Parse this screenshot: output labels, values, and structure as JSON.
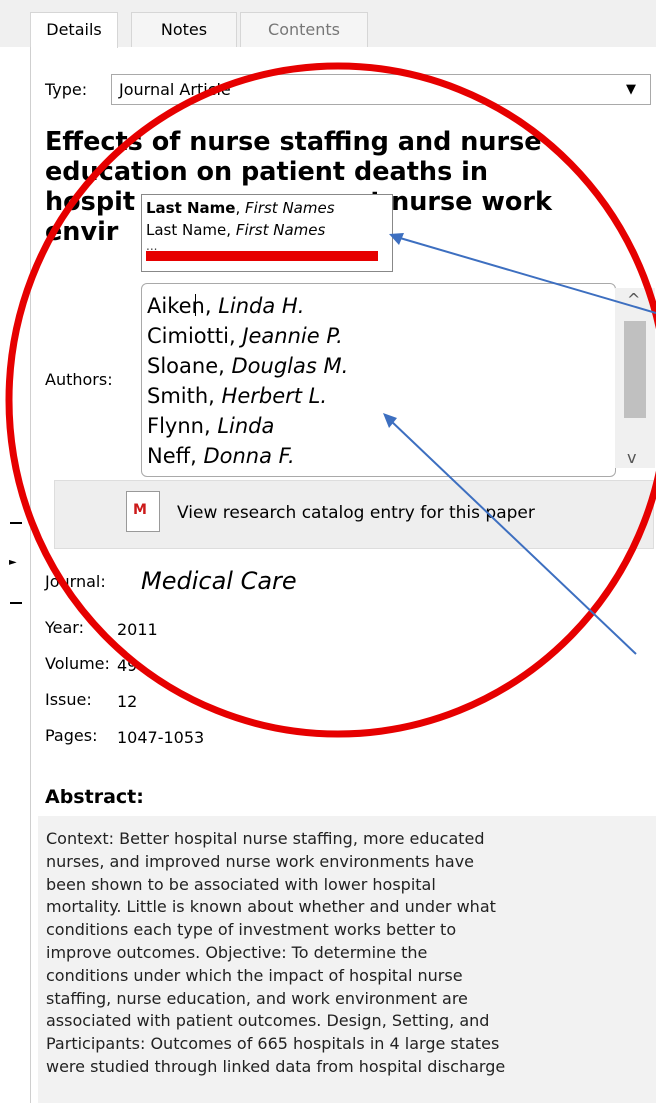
{
  "tabs": {
    "details": "Details",
    "notes": "Notes",
    "contents": "Contents"
  },
  "type_field": {
    "label": "Type:",
    "value": "Journal Article"
  },
  "title": "Effects of nurse staffing and nurse education on patient deaths in hospitals with different nurse work environments",
  "title_lines": [
    "Effects of nurse staffing and nurse",
    "education on patient deaths in",
    "hospit",
    "envir"
  ],
  "title_line3_tail": "t nurse work",
  "autocomplete": {
    "item1_last": "Last Name",
    "item1_first": "First Names",
    "item2_last": "Last Name",
    "item2_first": "First Names",
    "more": "..."
  },
  "authors": {
    "label": "Authors:",
    "items": [
      {
        "last": "Aiken",
        "first": "Linda H."
      },
      {
        "last": "Cimiotti",
        "first": "Jeannie P."
      },
      {
        "last": "Sloane",
        "first": "Douglas M."
      },
      {
        "last": "Smith",
        "first": "Herbert L."
      },
      {
        "last": "Flynn",
        "first": "Linda"
      },
      {
        "last": "Neff",
        "first": "Donna F."
      }
    ]
  },
  "catalog_button": {
    "label": "View research catalog entry for this paper",
    "icon_glyph": "M"
  },
  "journal": {
    "label": "Journal:",
    "value": "Medical Care"
  },
  "year": {
    "label": "Year:",
    "value": "2011"
  },
  "volume": {
    "label": "Volume:",
    "value": "49"
  },
  "issue": {
    "label": "Issue:",
    "value": "12"
  },
  "pages": {
    "label": "Pages:",
    "value": "1047-1053"
  },
  "abstract": {
    "heading": "Abstract:",
    "lines": [
      "Context: Better hospital nurse staffing, more educated",
      "nurses, and improved nurse work environments have",
      "been shown to be associated with lower hospital",
      "mortality. Little is known about whether and under what",
      "conditions each type of investment works better to",
      "improve outcomes. Objective: To determine the",
      "conditions under which the impact of hospital nurse",
      "staffing, nurse education, and work environment are",
      "associated with patient outcomes. Design, Setting, and",
      "Participants: Outcomes of 665 hospitals in 4 large states",
      "were studied through linked data from hospital discharge"
    ]
  },
  "colors": {
    "annotation_red": "#e60000",
    "annotation_blue": "#3d6fc0",
    "abstract_bg": "#f2f2f2",
    "tabbar_bg": "#f0f0f0"
  }
}
